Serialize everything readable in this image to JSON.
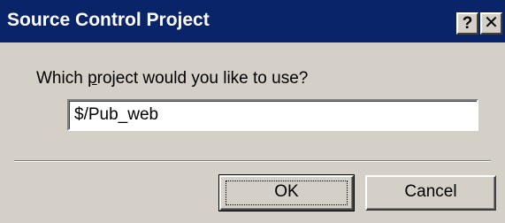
{
  "window": {
    "title": "Source Control Project",
    "help_glyph": "?",
    "close_glyph": "✕"
  },
  "prompt": {
    "before": "Which ",
    "mnemonic": "p",
    "after": "roject would you like to use?"
  },
  "project_field": {
    "value": "$/Pub_web"
  },
  "buttons": {
    "ok_label": "OK",
    "cancel_label": "Cancel"
  },
  "colors": {
    "title_bar": "#0a246a",
    "face": "#d4d0c8"
  }
}
